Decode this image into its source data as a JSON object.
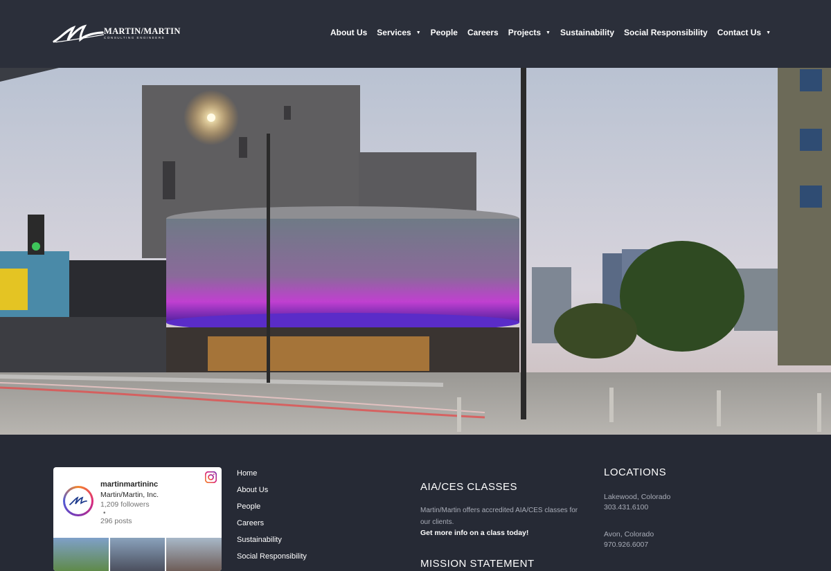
{
  "brand": {
    "name": "MARTIN/MARTIN",
    "tagline": "CONSULTING ENGINEERS"
  },
  "nav": [
    {
      "label": "About Us",
      "dropdown": false
    },
    {
      "label": "Services",
      "dropdown": true
    },
    {
      "label": "People",
      "dropdown": false
    },
    {
      "label": "Careers",
      "dropdown": false
    },
    {
      "label": "Projects",
      "dropdown": true
    },
    {
      "label": "Sustainability",
      "dropdown": false
    },
    {
      "label": "Social Responsibility",
      "dropdown": false
    },
    {
      "label": "Contact Us",
      "dropdown": true
    }
  ],
  "instagram": {
    "handle": "martinmartininc",
    "name": "Martin/Martin, Inc.",
    "followers": "1,209 followers",
    "separator": "•",
    "posts": "296 posts"
  },
  "footer_links": [
    "Home",
    "About Us",
    "People",
    "Careers",
    "Sustainability",
    "Social Responsibility"
  ],
  "aia": {
    "title": "AIA/CES CLASSES",
    "text": "Martin/Martin offers accredited AIA/CES classes for our clients.",
    "link": "Get more info on a class today!"
  },
  "mission": {
    "title": "MISSION STATEMENT"
  },
  "locations": {
    "title": "LOCATIONS",
    "items": [
      {
        "city": "Lakewood, Colorado",
        "phone": "303.431.6100"
      },
      {
        "city": "Avon, Colorado",
        "phone": "970.926.6007"
      }
    ]
  },
  "colors": {
    "header_bg": "#2b2f3a",
    "footer_bg": "#262a35",
    "muted_text": "#a9adb8"
  }
}
